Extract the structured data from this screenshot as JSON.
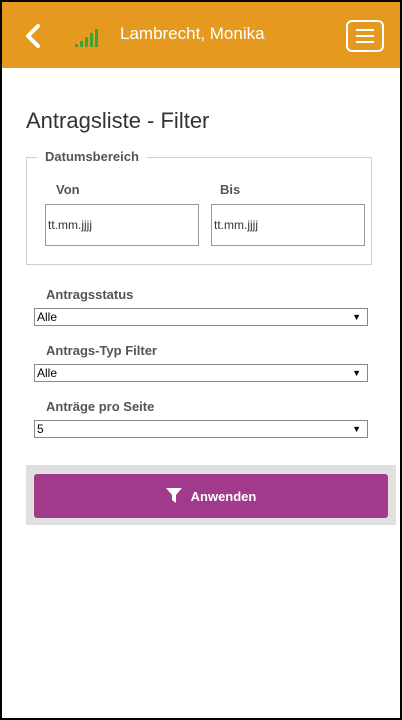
{
  "header": {
    "user_name": "Lambrecht, Monika",
    "icons": {
      "back": "chevron-left-icon",
      "signal": "signal-bars-icon",
      "menu": "hamburger-menu-icon"
    },
    "colors": {
      "background": "#e59a1f",
      "signal": "#3aa535"
    }
  },
  "page": {
    "title": "Antragsliste - Filter"
  },
  "date_range": {
    "legend": "Datumsbereich",
    "from_label": "Von",
    "to_label": "Bis",
    "from_placeholder": "tt.mm.jjjj",
    "to_placeholder": "tt.mm.jjjj"
  },
  "filters": {
    "status_label": "Antragsstatus",
    "status_value": "Alle",
    "type_label": "Antrags-Typ Filter",
    "type_value": "Alle",
    "per_page_label": "Anträge pro Seite",
    "per_page_value": "5"
  },
  "apply": {
    "label": "Anwenden",
    "icon": "filter-icon",
    "color": "#a13a8b"
  }
}
